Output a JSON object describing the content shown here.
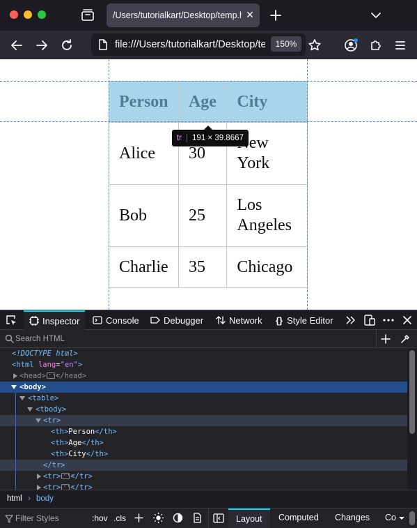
{
  "colors": {
    "chrome_bg": "#1c1b22",
    "toolbar_bg": "#2b2a33",
    "tab_bg": "#42414d",
    "accent": "#00ddff",
    "selection": "#204e8a",
    "header_row_bg": "#a9d6ea"
  },
  "browser": {
    "tab": {
      "title": "/Users/tutorialkart/Desktop/temp.html"
    },
    "url": "file:///Users/tutorialkart/Desktop/temp.html",
    "zoom": "150%"
  },
  "page": {
    "table": {
      "headers": [
        "Person",
        "Age",
        "City"
      ],
      "rows": [
        [
          "Alice",
          "30",
          "New York"
        ],
        [
          "Bob",
          "25",
          "Los Angeles"
        ],
        [
          "Charlie",
          "35",
          "Chicago"
        ]
      ]
    },
    "tooltip": {
      "tag": "tr",
      "size": "191 × 39.8667"
    }
  },
  "devtools": {
    "tabs": [
      "Inspector",
      "Console",
      "Debugger",
      "Network",
      "Style Editor"
    ],
    "search_placeholder": "Search HTML",
    "markup": {
      "doctype": "<!DOCTYPE html>",
      "html_open": "<html",
      "lang_attr": "lang",
      "lang_value": "\"en\"",
      "head_open": "<head>",
      "head_close": "</head>",
      "body": "<body>",
      "table": "<table>",
      "tbody": "<tbody>",
      "tr_open": "<tr>",
      "th_open": "<th>",
      "th_close": "</th>",
      "cells": [
        "Person",
        "Age",
        "City"
      ],
      "tr_close": "</tr>"
    },
    "breadcrumb": [
      "html",
      "body"
    ],
    "rules": {
      "filter_placeholder": "Filter Styles",
      "hov": ":hov",
      "cls": ".cls",
      "sidebar_tabs": [
        "Layout",
        "Computed",
        "Changes",
        "Co"
      ]
    }
  }
}
